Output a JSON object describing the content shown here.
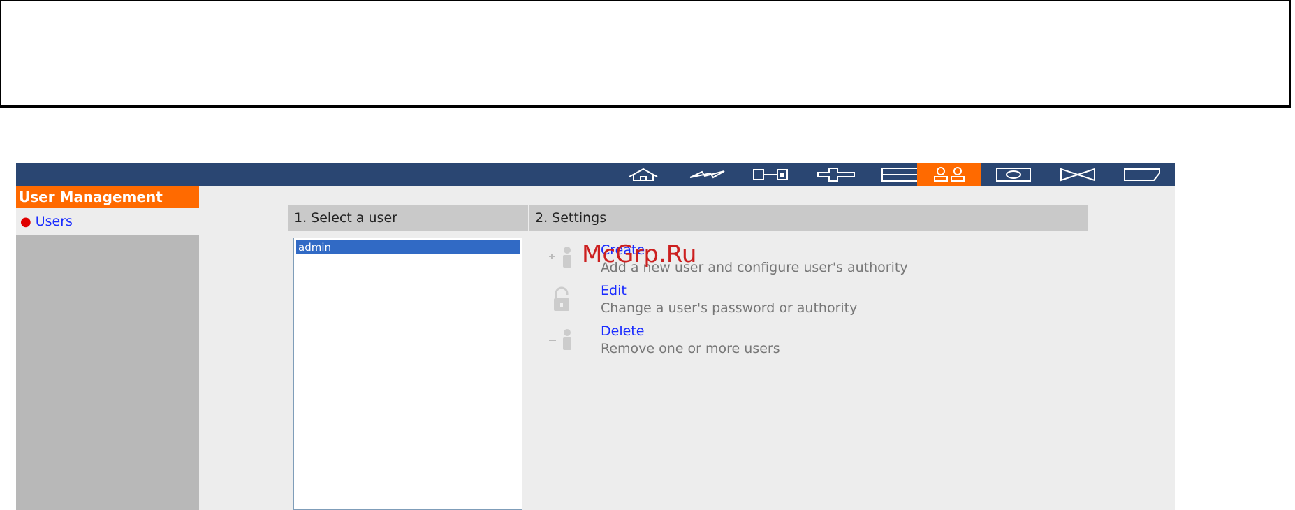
{
  "sidebar": {
    "title": "User Management",
    "items": [
      {
        "label": "Users"
      }
    ]
  },
  "nav": {
    "icons": [
      "home-icon",
      "network-icon",
      "hardware-icon",
      "services-icon",
      "storage-icon",
      "users-icon",
      "backup-icon",
      "tools-icon",
      "status-icon"
    ],
    "active": "users-icon"
  },
  "columns": {
    "select_user": "1. Select a user",
    "settings": "2. Settings"
  },
  "users": [
    "admin"
  ],
  "actions": [
    {
      "title": "Create",
      "desc": "Add a new user and configure user's authority"
    },
    {
      "title": "Edit",
      "desc": "Change a user's password or authority"
    },
    {
      "title": "Delete",
      "desc": "Remove one or more users"
    }
  ],
  "watermark": "McGrp.Ru",
  "colors": {
    "accent": "#ff6a00",
    "nav_bg": "#2a4672",
    "link": "#1a2cff",
    "selection": "#316ac5"
  }
}
